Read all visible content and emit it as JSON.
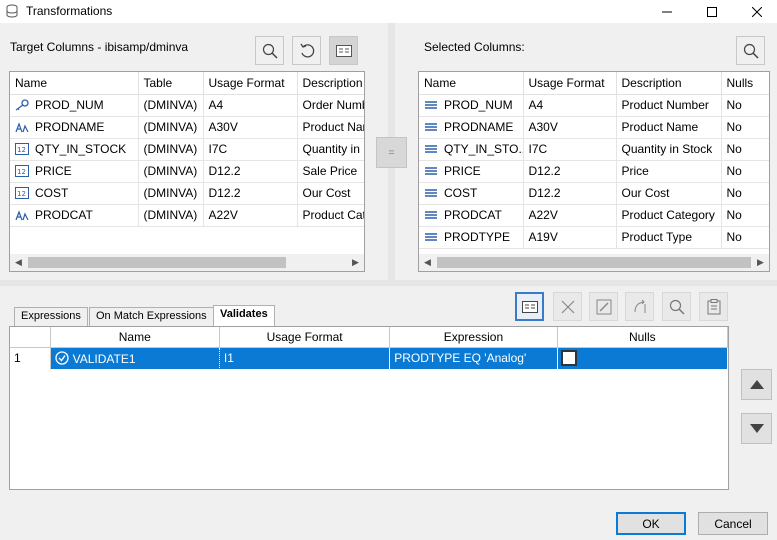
{
  "window": {
    "title": "Transformations"
  },
  "target_panel": {
    "label": "Target Columns - ibisamp/dminva",
    "columns": [
      "Name",
      "Table",
      "Usage Format",
      "Description"
    ],
    "rows": [
      {
        "icon": "key-icon",
        "name": "PROD_NUM",
        "table": "(DMINVA)",
        "format": "A4",
        "description": "Order Numb"
      },
      {
        "icon": "alpha-field-icon",
        "name": "PRODNAME",
        "table": "(DMINVA)",
        "format": "A30V",
        "description": "Product Nar"
      },
      {
        "icon": "numeric-field-icon",
        "name": "QTY_IN_STOCK",
        "table": "(DMINVA)",
        "format": "I7C",
        "description": "Quantity in"
      },
      {
        "icon": "numeric-field-icon",
        "name": "PRICE",
        "table": "(DMINVA)",
        "format": "D12.2",
        "description": "Sale Price"
      },
      {
        "icon": "numeric-field-icon",
        "name": "COST",
        "table": "(DMINVA)",
        "format": "D12.2",
        "description": "Our Cost"
      },
      {
        "icon": "alpha-field-icon",
        "name": "PRODCAT",
        "table": "(DMINVA)",
        "format": "A22V",
        "description": "Product Cat"
      }
    ]
  },
  "mid_button": {
    "label": "="
  },
  "selected_panel": {
    "label": "Selected Columns:",
    "columns": [
      "Name",
      "Usage Format",
      "Description",
      "Nulls"
    ],
    "rows": [
      {
        "name": "PROD_NUM",
        "format": "A4",
        "description": "Product Number",
        "nulls": "No"
      },
      {
        "name": "PRODNAME",
        "format": "A30V",
        "description": "Product Name",
        "nulls": "No"
      },
      {
        "name": "QTY_IN_STO...",
        "format": "I7C",
        "description": "Quantity in Stock",
        "nulls": "No"
      },
      {
        "name": "PRICE",
        "format": "D12.2",
        "description": "Price",
        "nulls": "No"
      },
      {
        "name": "COST",
        "format": "D12.2",
        "description": "Our Cost",
        "nulls": "No"
      },
      {
        "name": "PRODCAT",
        "format": "A22V",
        "description": "Product Category",
        "nulls": "No"
      },
      {
        "name": "PRODTYPE",
        "format": "A19V",
        "description": "Product Type",
        "nulls": "No"
      }
    ]
  },
  "tabs": [
    {
      "label": "Expressions",
      "active": false
    },
    {
      "label": "On Match Expressions",
      "active": false
    },
    {
      "label": "Validates",
      "active": true
    }
  ],
  "validates_grid": {
    "columns": [
      "Name",
      "Usage Format",
      "Expression",
      "Nulls"
    ],
    "rows": [
      {
        "index": "1",
        "name": "VALIDATE1",
        "format": "I1",
        "expression": "PRODTYPE EQ 'Analog'",
        "nulls_checked": false
      }
    ]
  },
  "buttons": {
    "ok": "OK",
    "cancel": "Cancel"
  }
}
